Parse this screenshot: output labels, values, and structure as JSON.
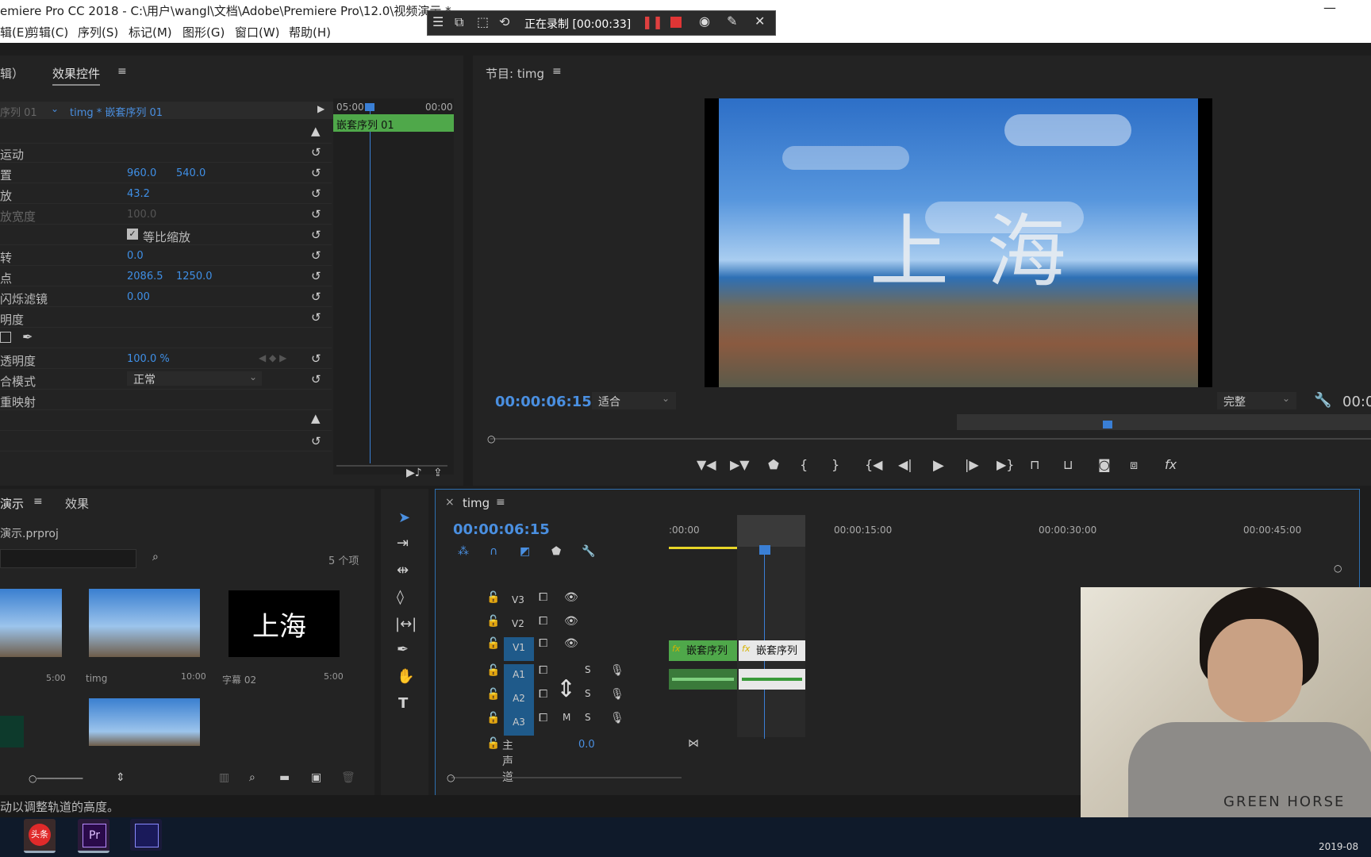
{
  "app": {
    "title": "emiere Pro CC 2018 - C:\\用户\\wangl\\文档\\Adobe\\Premiere Pro\\12.0\\视频演示 *"
  },
  "menu": [
    "辑(E)",
    "剪辑(C)",
    "序列(S)",
    "标记(M)",
    "图形(G)",
    "窗口(W)",
    "帮助(H)"
  ],
  "recorder": {
    "status": "正在录制 [00:00:33]"
  },
  "effects_panel": {
    "tab_prev": "辑）",
    "tab": "效果控件",
    "source": "序列 01",
    "clip": "timg * 嵌套序列 01",
    "ruler_left": "05:00",
    "ruler_right": "00:00",
    "mini_clip": "嵌套序列 01",
    "rows": [
      {
        "label": "运动",
        "v1": "",
        "v2": ""
      },
      {
        "label": "置",
        "v1": "960.0",
        "v2": "540.0"
      },
      {
        "label": "放",
        "v1": "43.2",
        "v2": ""
      },
      {
        "label": "放宽度",
        "v1": "100.0",
        "v2": ""
      },
      {
        "label": "",
        "v1": "等比缩放",
        "v2": ""
      },
      {
        "label": "转",
        "v1": "0.0",
        "v2": ""
      },
      {
        "label": "点",
        "v1": "2086.5",
        "v2": "1250.0"
      },
      {
        "label": "闪烁滤镜",
        "v1": "0.00",
        "v2": ""
      },
      {
        "label": "明度",
        "v1": "",
        "v2": ""
      },
      {
        "label": "",
        "v1": "",
        "v2": ""
      },
      {
        "label": "透明度",
        "v1": "100.0 %",
        "v2": ""
      },
      {
        "label": "合模式",
        "v1": "正常",
        "v2": ""
      },
      {
        "label": "重映射",
        "v1": "",
        "v2": ""
      }
    ]
  },
  "program": {
    "title": "节目: timg",
    "timecode": "00:00:06:15",
    "fit": "适合",
    "quality": "完整",
    "timecode_right": "00:00",
    "overlay_text": "上 海"
  },
  "project": {
    "tab": "演示",
    "tab2": "效果",
    "file": "演示.prproj",
    "count": "5 个项",
    "items": [
      {
        "name": "",
        "dur": "5:00"
      },
      {
        "name": "timg",
        "dur": "10:00"
      },
      {
        "name": "字幕 02",
        "dur": "5:00",
        "title": "上海"
      }
    ]
  },
  "timeline": {
    "tab": "timg",
    "timecode": "00:00:06:15",
    "ruler": [
      ":00:00",
      "00:00:15:00",
      "00:00:30:00",
      "00:00:45:00"
    ],
    "tracks": {
      "video": [
        "V3",
        "V2",
        "V1"
      ],
      "audio": [
        "A1",
        "A2",
        "A3"
      ],
      "master": "主声道",
      "master_val": "0.0"
    },
    "clip1": "嵌套序列",
    "clip2": "嵌套序列",
    "fx": "fx"
  },
  "status": {
    "text": "动以调整轨道的高度。",
    "date": "2019-08"
  },
  "webcam": {
    "shirt_text": "GREEN HORSE"
  },
  "taskbar": {
    "app1": "头条",
    "app2": "Pr"
  }
}
